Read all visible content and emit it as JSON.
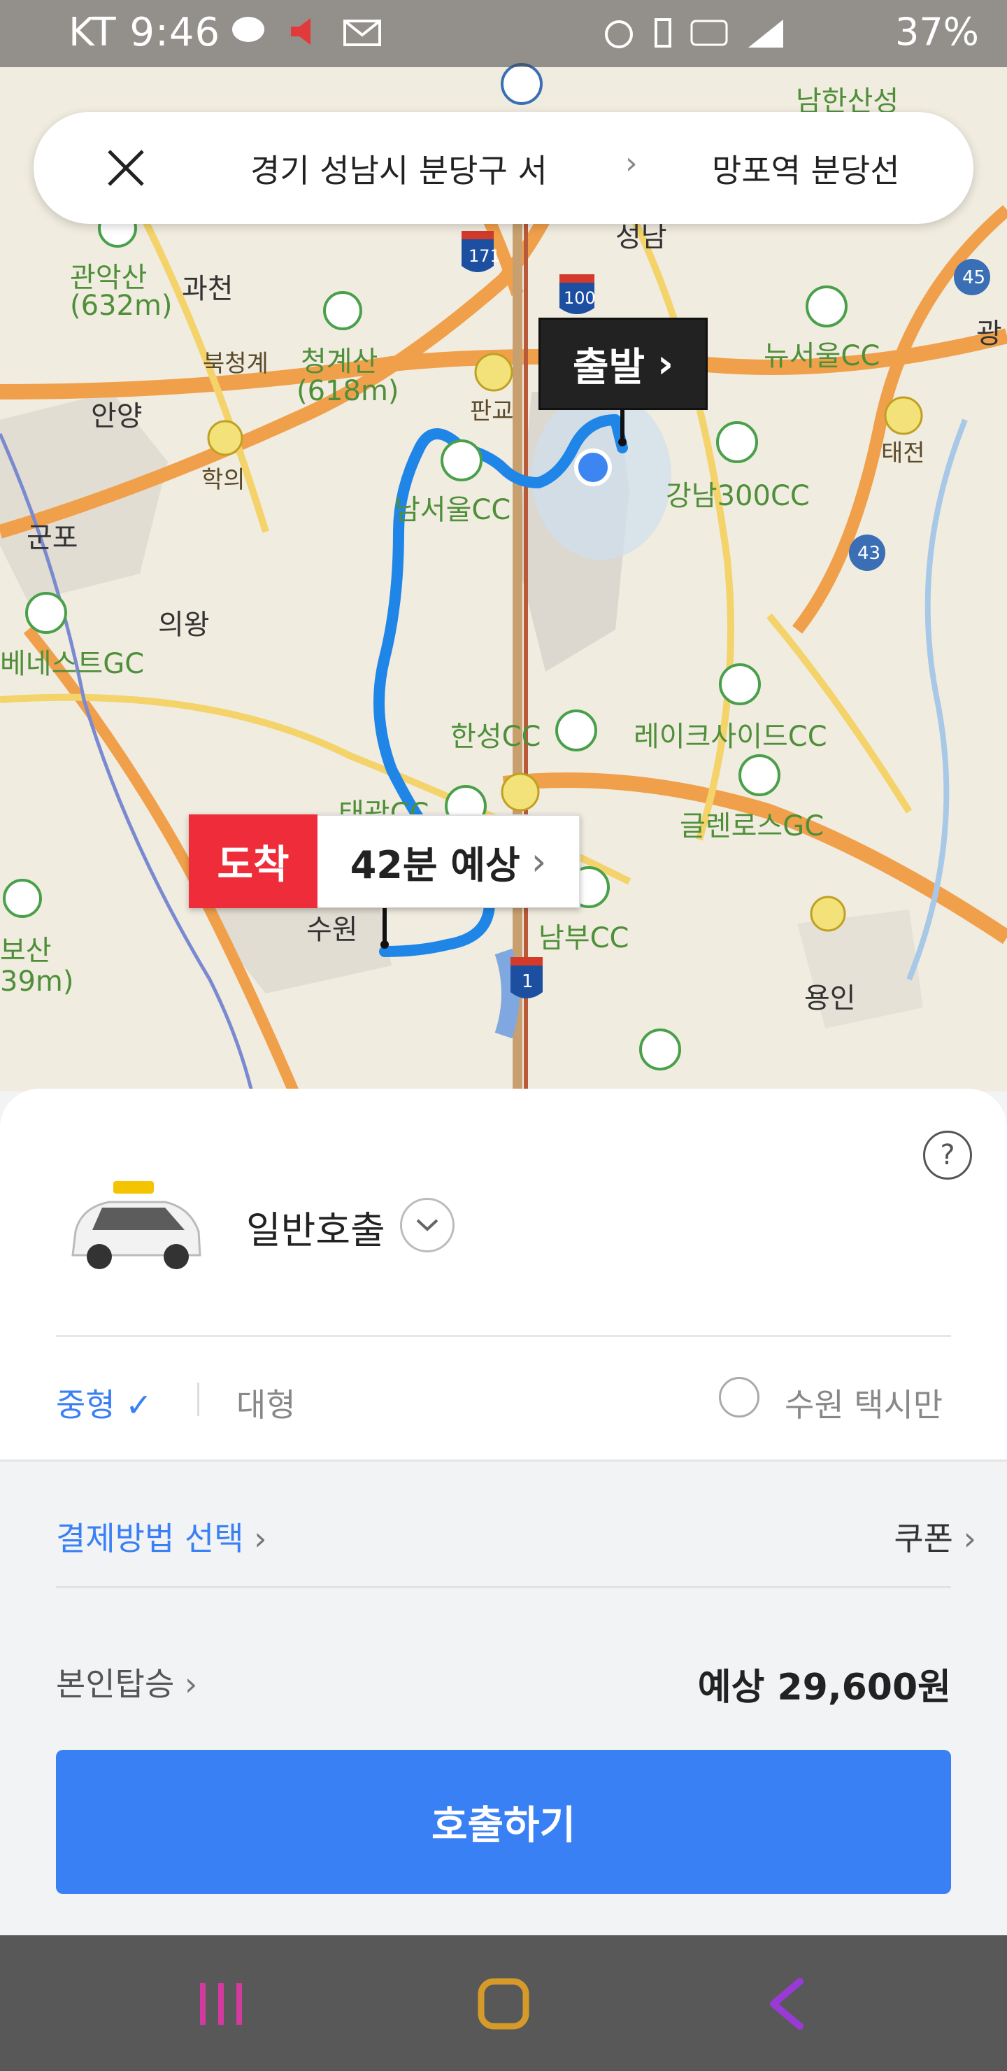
{
  "status_bar": {
    "carrier_time": "KT 9:46",
    "battery": "37%"
  },
  "route": {
    "from": "경기 성남시 분당구 서",
    "to": "망포역 분당선"
  },
  "map": {
    "depart_label": "출발",
    "arrive_label": "도착",
    "eta_label": "42분 예상",
    "places": [
      "남한산성",
      "성남",
      "관악산",
      "(632m)",
      "과천",
      "북청계",
      "청계산",
      "(618m)",
      "판교",
      "뉴서울CC",
      "안양",
      "학의",
      "태전",
      "남서울CC",
      "강남300CC",
      "군포",
      "의왕",
      "베네스트GC",
      "한성CC",
      "레이크사이드CC",
      "글렌로스GC",
      "태광CC",
      "수원",
      "남부CC",
      "용인",
      "보산",
      "39m)",
      "광"
    ],
    "road_numbers": [
      "171",
      "100",
      "45",
      "43",
      "1"
    ]
  },
  "panel": {
    "call_type": "일반호출",
    "size_mid": "중형",
    "size_large": "대형",
    "suwon_only": "수원 택시만",
    "payment": "결제방법 선택",
    "coupon": "쿠폰",
    "self_ride": "본인탑승",
    "fare": "예상 29,600원",
    "call_button": "호출하기"
  },
  "colors": {
    "accent": "#3a80f5",
    "arrive_red": "#ef2c3a",
    "route_blue": "#1f86e8"
  }
}
